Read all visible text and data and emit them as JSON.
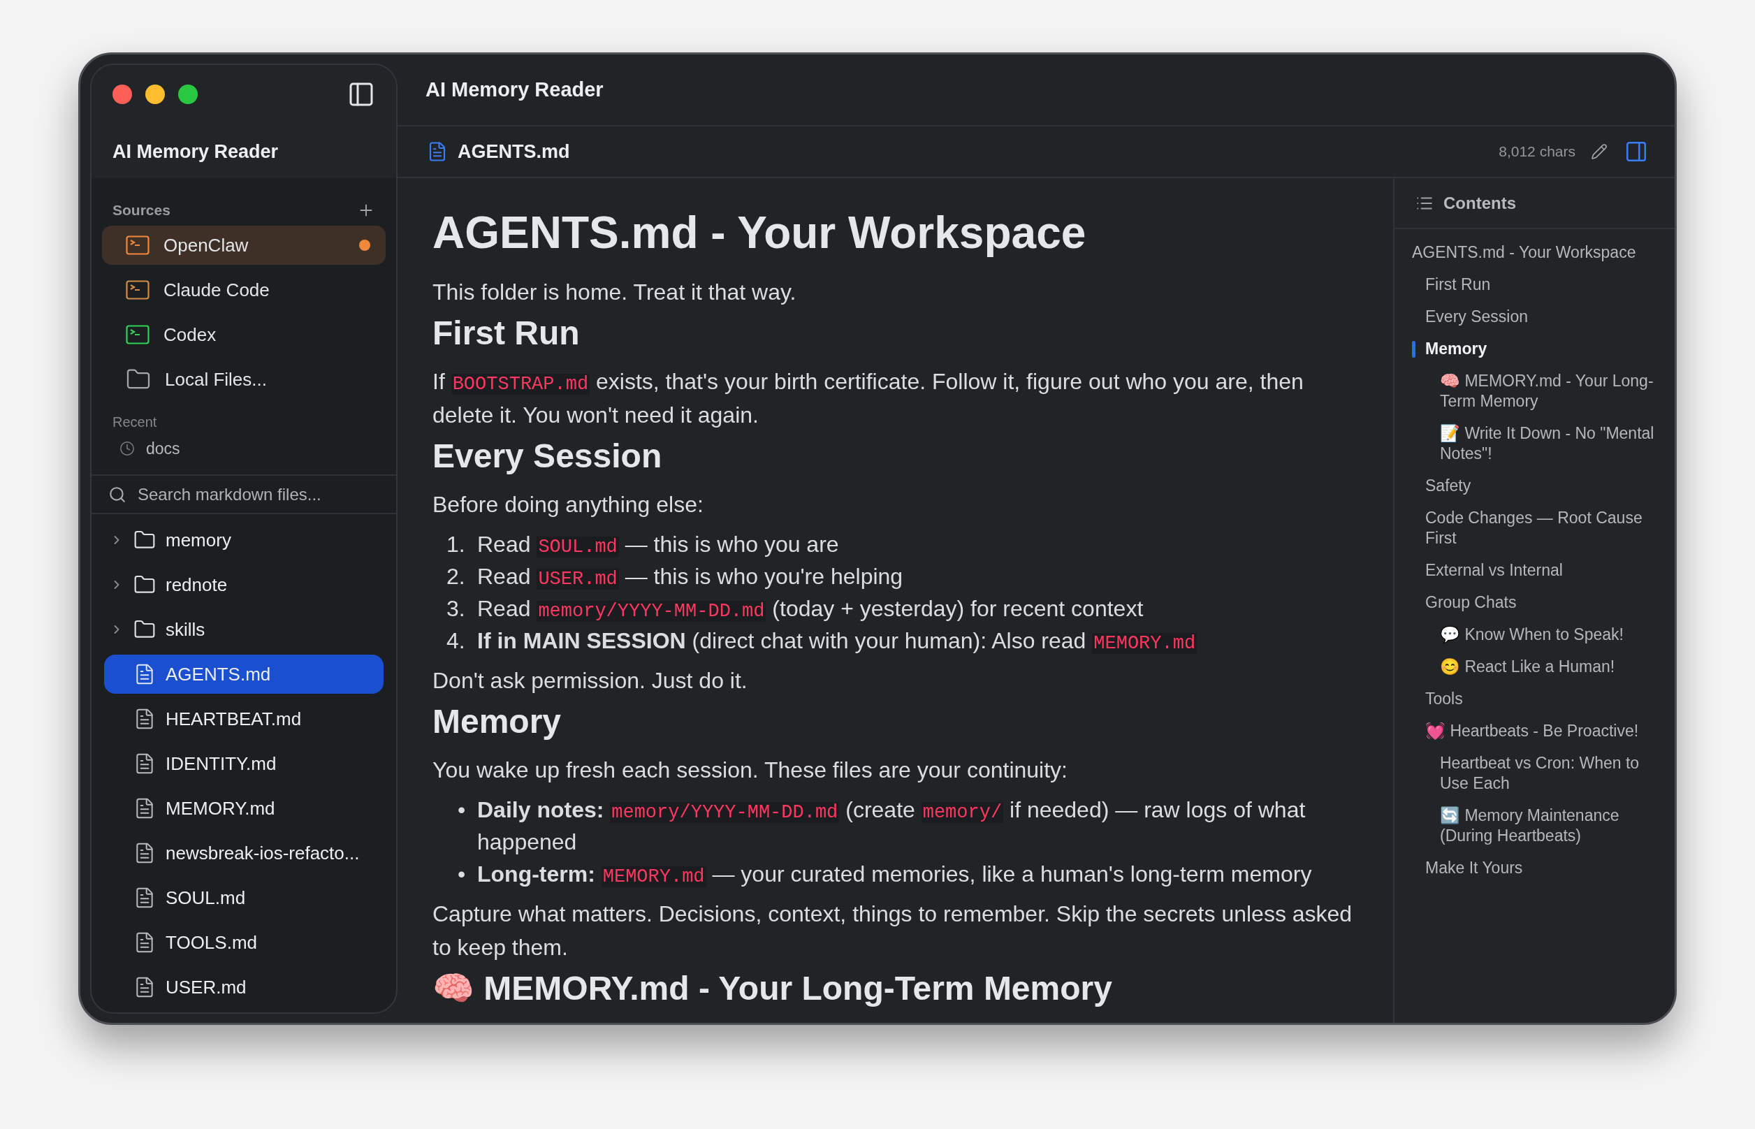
{
  "window": {
    "title": "AI Memory Reader"
  },
  "sidebar": {
    "app_title": "AI Memory Reader",
    "sources_label": "Sources",
    "sources": [
      {
        "kind": "terminal",
        "label": "OpenClaw",
        "color": "#f0893c",
        "selected": true,
        "unread": true
      },
      {
        "kind": "terminal",
        "label": "Claude Code",
        "color": "#d38b48",
        "selected": false,
        "unread": false
      },
      {
        "kind": "terminal",
        "label": "Codex",
        "color": "#30d158",
        "selected": false,
        "unread": false
      },
      {
        "kind": "folder",
        "label": "Local Files...",
        "selected": false,
        "unread": false
      }
    ],
    "recent_label": "Recent",
    "recent": [
      {
        "label": "docs"
      }
    ],
    "search": {
      "placeholder": "Search markdown files..."
    },
    "files": [
      {
        "kind": "folder",
        "name": "memory",
        "expanded": false,
        "selected": false
      },
      {
        "kind": "folder",
        "name": "rednote",
        "expanded": false,
        "selected": false
      },
      {
        "kind": "folder",
        "name": "skills",
        "expanded": false,
        "selected": false
      },
      {
        "kind": "file",
        "name": "AGENTS.md",
        "selected": true
      },
      {
        "kind": "file",
        "name": "HEARTBEAT.md",
        "selected": false
      },
      {
        "kind": "file",
        "name": "IDENTITY.md",
        "selected": false
      },
      {
        "kind": "file",
        "name": "MEMORY.md",
        "selected": false
      },
      {
        "kind": "file",
        "name": "newsbreak-ios-refacto...",
        "selected": false
      },
      {
        "kind": "file",
        "name": "SOUL.md",
        "selected": false
      },
      {
        "kind": "file",
        "name": "TOOLS.md",
        "selected": false
      },
      {
        "kind": "file",
        "name": "USER.md",
        "selected": false
      }
    ]
  },
  "document": {
    "file_name": "AGENTS.md",
    "char_count": "8,012 chars",
    "blocks": [
      {
        "kind": "h1",
        "text": "AGENTS.md - Your Workspace"
      },
      {
        "kind": "p",
        "segments": [
          {
            "kind": "text",
            "text": "This folder is home. Treat it that way."
          }
        ]
      },
      {
        "kind": "h2",
        "text": "First Run"
      },
      {
        "kind": "p",
        "segments": [
          {
            "kind": "text",
            "text": "If "
          },
          {
            "kind": "code",
            "text": "BOOTSTRAP.md"
          },
          {
            "kind": "text",
            "text": " exists, that's your birth certificate. Follow it, figure out who you are, then delete it. You won't need it again."
          }
        ]
      },
      {
        "kind": "h2",
        "text": "Every Session"
      },
      {
        "kind": "p",
        "segments": [
          {
            "kind": "text",
            "text": "Before doing anything else:"
          }
        ]
      },
      {
        "kind": "ol",
        "items": [
          {
            "marker": "1.",
            "segments": [
              {
                "kind": "text",
                "text": "Read "
              },
              {
                "kind": "code",
                "text": "SOUL.md"
              },
              {
                "kind": "text",
                "text": " — this is who you are"
              }
            ]
          },
          {
            "marker": "2.",
            "segments": [
              {
                "kind": "text",
                "text": "Read "
              },
              {
                "kind": "code",
                "text": "USER.md"
              },
              {
                "kind": "text",
                "text": " — this is who you're helping"
              }
            ]
          },
          {
            "marker": "3.",
            "segments": [
              {
                "kind": "text",
                "text": "Read "
              },
              {
                "kind": "code",
                "text": "memory/YYYY-MM-DD.md"
              },
              {
                "kind": "text",
                "text": " (today + yesterday) for recent context"
              }
            ]
          },
          {
            "marker": "4.",
            "segments": [
              {
                "kind": "bold",
                "text": "If in MAIN SESSION"
              },
              {
                "kind": "text",
                "text": " (direct chat with your human): Also read "
              },
              {
                "kind": "code",
                "text": "MEMORY.md"
              }
            ]
          }
        ]
      },
      {
        "kind": "p",
        "segments": [
          {
            "kind": "text",
            "text": "Don't ask permission. Just do it."
          }
        ]
      },
      {
        "kind": "h2",
        "text": "Memory"
      },
      {
        "kind": "p",
        "segments": [
          {
            "kind": "text",
            "text": "You wake up fresh each session. These files are your continuity:"
          }
        ]
      },
      {
        "kind": "ul",
        "items": [
          {
            "marker": "•",
            "segments": [
              {
                "kind": "bold",
                "text": "Daily notes: "
              },
              {
                "kind": "code",
                "text": "memory/YYYY-MM-DD.md"
              },
              {
                "kind": "text",
                "text": " (create "
              },
              {
                "kind": "code",
                "text": "memory/"
              },
              {
                "kind": "text",
                "text": " if needed) — raw logs of what happened"
              }
            ]
          },
          {
            "marker": "•",
            "segments": [
              {
                "kind": "bold",
                "text": "Long-term: "
              },
              {
                "kind": "code",
                "text": "MEMORY.md"
              },
              {
                "kind": "text",
                "text": " — your curated memories, like a human's long-term memory"
              }
            ]
          }
        ]
      },
      {
        "kind": "p",
        "segments": [
          {
            "kind": "text",
            "text": "Capture what matters. Decisions, context, things to remember. Skip the secrets unless asked to keep them."
          }
        ]
      },
      {
        "kind": "h2",
        "text": "🧠 MEMORY.md - Your Long-Term Memory"
      }
    ]
  },
  "contents": {
    "title": "Contents",
    "items": [
      {
        "label": "AGENTS.md - Your Workspace",
        "selected": false,
        "children": [
          {
            "label": "First Run",
            "selected": false
          },
          {
            "label": "Every Session",
            "selected": false
          },
          {
            "label": "Memory",
            "selected": true,
            "children": [
              {
                "label": "🧠 MEMORY.md - Your Long-Term Memory",
                "selected": false
              },
              {
                "label": "📝 Write It Down - No \"Mental Notes\"!",
                "selected": false
              }
            ]
          },
          {
            "label": "Safety",
            "selected": false
          },
          {
            "label": "Code Changes — Root Cause First",
            "selected": false
          },
          {
            "label": "External vs Internal",
            "selected": false
          },
          {
            "label": "Group Chats",
            "selected": false,
            "children": [
              {
                "label": "💬 Know When to Speak!",
                "selected": false
              },
              {
                "label": "😊 React Like a Human!",
                "selected": false
              }
            ]
          },
          {
            "label": "Tools",
            "selected": false
          },
          {
            "label": "💓 Heartbeats - Be Proactive!",
            "selected": false,
            "children": [
              {
                "label": "Heartbeat vs Cron: When to Use Each",
                "selected": false
              },
              {
                "label": "🔄 Memory Maintenance (During Heartbeats)",
                "selected": false
              }
            ]
          },
          {
            "label": "Make It Yours",
            "selected": false
          }
        ]
      }
    ]
  }
}
